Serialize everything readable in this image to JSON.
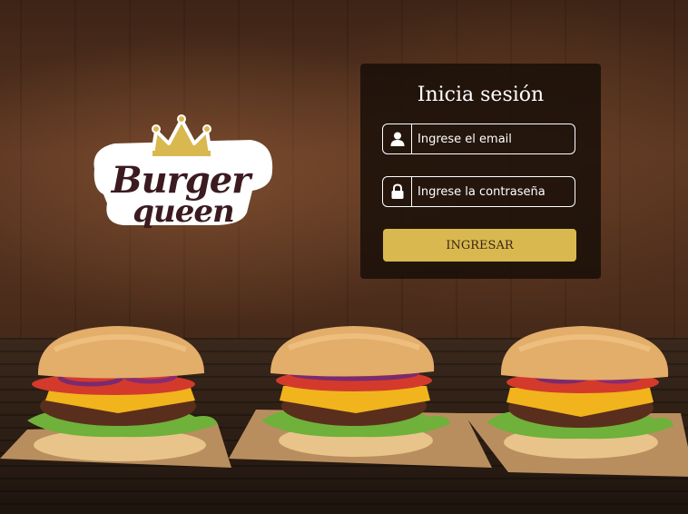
{
  "brand": {
    "logo_text": "Burger queen"
  },
  "login": {
    "title": "Inicia sesión",
    "email_placeholder": "Ingrese el email",
    "password_placeholder": "Ingrese la contraseña",
    "submit_label": "INGRESAR"
  },
  "colors": {
    "accent": "#d9b84f",
    "panel": "#160d07",
    "logo_dark": "#3b1a20",
    "crown": "#d9b84f"
  },
  "icons": [
    "user-icon",
    "lock-icon"
  ]
}
